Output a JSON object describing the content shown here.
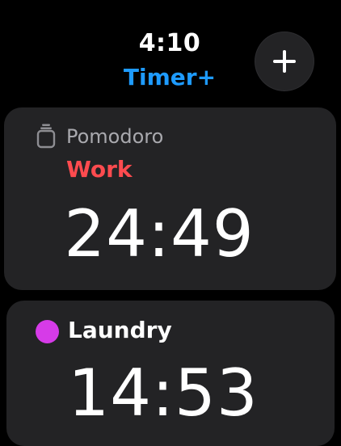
{
  "status": {
    "time": "4:10"
  },
  "header": {
    "title": "Timer+",
    "title_color": "#1e9bff"
  },
  "add_button": {
    "icon": "plus-icon"
  },
  "timers": [
    {
      "icon": "timer-icon",
      "label": "Pomodoro",
      "phase": "Work",
      "phase_color": "#ff4b4f",
      "remaining": "24:49"
    },
    {
      "icon": "color-dot",
      "dot_color": "#d63be8",
      "label": "Laundry",
      "remaining": "14:53"
    }
  ],
  "colors": {
    "background": "#000000",
    "card": "#232325"
  }
}
